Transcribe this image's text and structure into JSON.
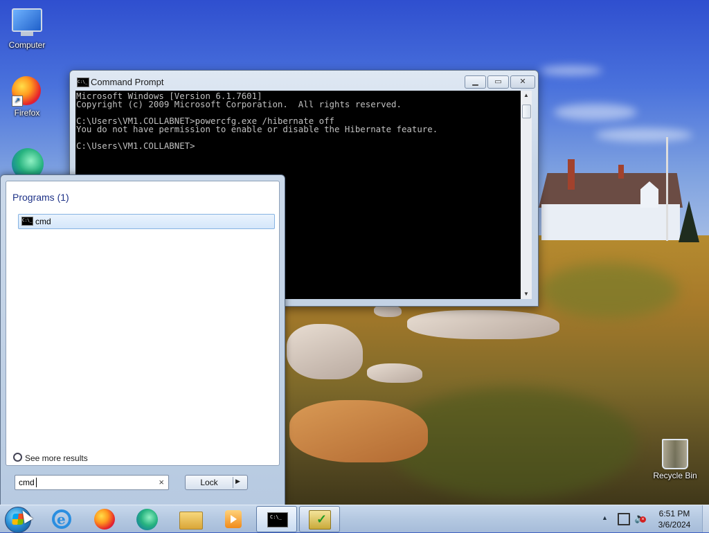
{
  "desktop": {
    "icons": [
      {
        "label": "Computer",
        "icon": "computer-icon"
      },
      {
        "label": "Firefox",
        "icon": "firefox-icon"
      },
      {
        "label": "",
        "icon": "edge-icon"
      },
      {
        "label": "Recycle Bin",
        "icon": "recycle-bin-icon"
      }
    ]
  },
  "cmd_window": {
    "title": "Command Prompt",
    "console_lines": [
      "Microsoft Windows [Version 6.1.7601]",
      "Copyright (c) 2009 Microsoft Corporation.  All rights reserved.",
      "",
      "C:\\Users\\VM1.COLLABNET>powercfg.exe /hibernate off",
      "You do not have permission to enable or disable the Hibernate feature.",
      "",
      "C:\\Users\\VM1.COLLABNET>"
    ],
    "icon_text": "C:\\_"
  },
  "start_menu": {
    "programs_header": "Programs (1)",
    "results": [
      {
        "label": "cmd",
        "icon": "cmd-icon"
      }
    ],
    "see_more": "See more results",
    "search_value": "cmd",
    "clear_glyph": "×",
    "lock_label": "Lock",
    "lock_arrow": "▶"
  },
  "taskbar": {
    "pinned": [
      "internet-explorer-icon",
      "firefox-icon",
      "edge-icon",
      "file-explorer-icon",
      "media-player-icon"
    ],
    "running": [
      "command-prompt",
      "action-center"
    ],
    "cmd_icon_text": "C:\\_",
    "tray_arrow": "▲",
    "clock_time": "6:51 PM",
    "clock_date": "3/6/2024"
  }
}
